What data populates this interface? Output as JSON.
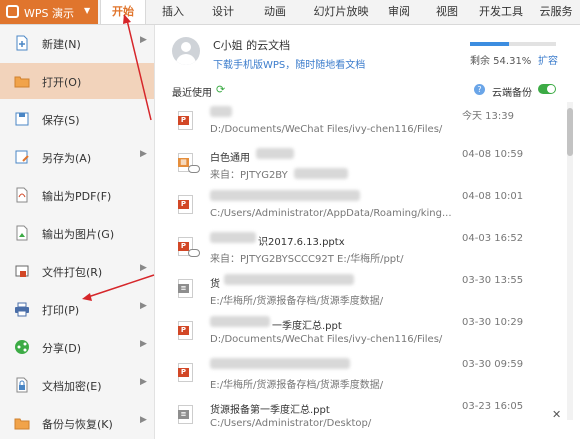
{
  "topbar": {
    "app_name": "WPS 演示",
    "tabs": [
      "开始",
      "插入",
      "设计",
      "动画",
      "幻灯片放映",
      "审阅",
      "视图",
      "开发工具",
      "云服务"
    ]
  },
  "menu": {
    "items": [
      {
        "label": "新建(N)",
        "icon": "new-file-icon",
        "has_arrow": true
      },
      {
        "label": "打开(O)",
        "icon": "open-folder-icon",
        "has_arrow": false
      },
      {
        "label": "保存(S)",
        "icon": "save-icon",
        "has_arrow": false
      },
      {
        "label": "另存为(A)",
        "icon": "save-as-icon",
        "has_arrow": true
      },
      {
        "label": "输出为PDF(F)",
        "icon": "pdf-export-icon",
        "has_arrow": false
      },
      {
        "label": "输出为图片(G)",
        "icon": "image-export-icon",
        "has_arrow": false
      },
      {
        "label": "文件打包(R)",
        "icon": "package-icon",
        "has_arrow": true
      },
      {
        "label": "打印(P)",
        "icon": "printer-icon",
        "has_arrow": true
      },
      {
        "label": "分享(D)",
        "icon": "share-icon",
        "has_arrow": true
      },
      {
        "label": "文档加密(E)",
        "icon": "lock-icon",
        "has_arrow": true
      },
      {
        "label": "备份与恢复(K)",
        "icon": "backup-icon",
        "has_arrow": true
      }
    ]
  },
  "cloud": {
    "user_title": "C小姐 的云文档",
    "download_link": "下载手机版WPS，随时随地看文档",
    "quota_text": "剩余 54.31%",
    "quota_fraction": 0.4569,
    "expand_label": "扩容"
  },
  "recent": {
    "label": "最近使用",
    "backup_label": "云端备份",
    "backup_on": true
  },
  "files": [
    {
      "name": "",
      "path": "D:/Documents/WeChat Files/ivy-chen116/Files/",
      "date": "今天 13:39",
      "type": "ppt"
    },
    {
      "name": "白色通用",
      "path": "来自：PJTYG2BY",
      "date": "04-08 10:59",
      "type": "template"
    },
    {
      "name": "",
      "path": "C:/Users/Administrator/AppData/Roaming/king...",
      "date": "04-08 10:01",
      "type": "ppt"
    },
    {
      "name": "识2017.6.13.pptx",
      "path": "来自：PJTYG2BYSCCC92T  E:/华梅所/ppt/",
      "date": "04-03 16:52",
      "type": "ppt"
    },
    {
      "name": "货",
      "path": "E:/华梅所/货源报备存档/货源季度数据/",
      "date": "03-30 13:55",
      "type": "doc"
    },
    {
      "name": "一季度汇总.ppt",
      "path": "D:/Documents/WeChat Files/ivy-chen116/Files/",
      "date": "03-30 10:29",
      "type": "ppt"
    },
    {
      "name": "",
      "path": "E:/华梅所/货源报备存档/货源季度数据/",
      "date": "03-30 09:59",
      "type": "ppt"
    },
    {
      "name": "货源报备第一季度汇总.ppt",
      "path": "C:/Users/Administrator/Desktop/",
      "date": "03-23 16:05",
      "type": "doc"
    }
  ],
  "colors": {
    "accent": "#e0752d",
    "link": "#3b7ccc",
    "ppt": "#d24726",
    "green": "#3cab45"
  }
}
